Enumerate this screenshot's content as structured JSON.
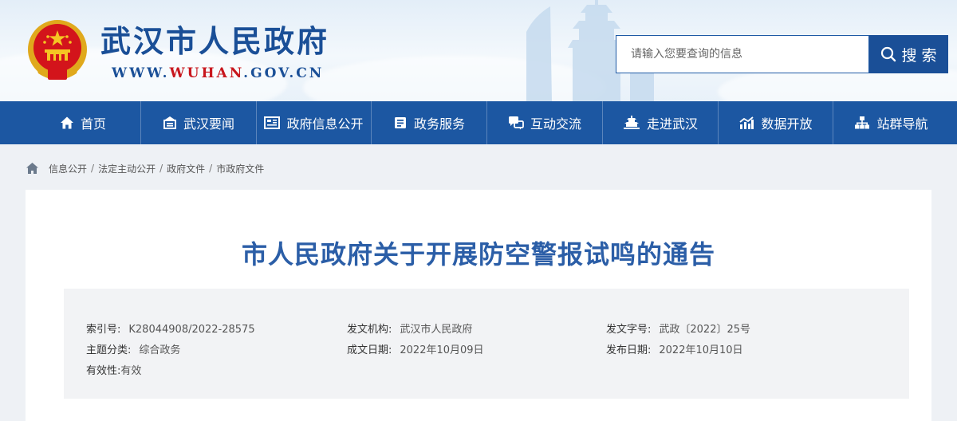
{
  "header": {
    "site_title": "武汉市人民政府",
    "site_url_prefix": "WWW.",
    "site_url_highlight": "WUHAN",
    "site_url_suffix": ".GOV.CN",
    "emblem_icon": "national-emblem-icon",
    "search": {
      "placeholder": "请输入您要查询的信息",
      "button_label": "搜 索",
      "button_icon": "search-icon"
    }
  },
  "nav": {
    "items": [
      {
        "label": "首页",
        "icon": "home-icon"
      },
      {
        "label": "武汉要闻",
        "icon": "news-icon"
      },
      {
        "label": "政府信息公开",
        "icon": "info-disclosure-icon"
      },
      {
        "label": "政务服务",
        "icon": "service-icon"
      },
      {
        "label": "互动交流",
        "icon": "interaction-icon"
      },
      {
        "label": "走进武汉",
        "icon": "landmark-icon"
      },
      {
        "label": "数据开放",
        "icon": "chart-icon"
      },
      {
        "label": "站群导航",
        "icon": "site-map-icon"
      }
    ]
  },
  "breadcrumb": {
    "icon": "home-icon",
    "items": [
      "信息公开",
      "法定主动公开",
      "政府文件",
      "市政府文件"
    ],
    "separator": "/"
  },
  "article": {
    "title": "市人民政府关于开展防空警报试鸣的通告",
    "meta": {
      "index_label": "索引号:",
      "index_value": "K28044908/2022-28575",
      "issuer_label": "发文机构:",
      "issuer_value": "武汉市人民政府",
      "doc_no_label": "发文字号:",
      "doc_no_value": "武政〔2022〕25号",
      "category_label": "主题分类:",
      "category_value": "综合政务",
      "created_label": "成文日期:",
      "created_value": "2022年10月09日",
      "published_label": "发布日期:",
      "published_value": "2022年10月10日",
      "validity_label": "有效性:",
      "validity_value": "有效"
    }
  },
  "colors": {
    "brand_blue": "#1c57a2",
    "title_blue": "#2b5ea7",
    "url_red": "#c8161d"
  }
}
